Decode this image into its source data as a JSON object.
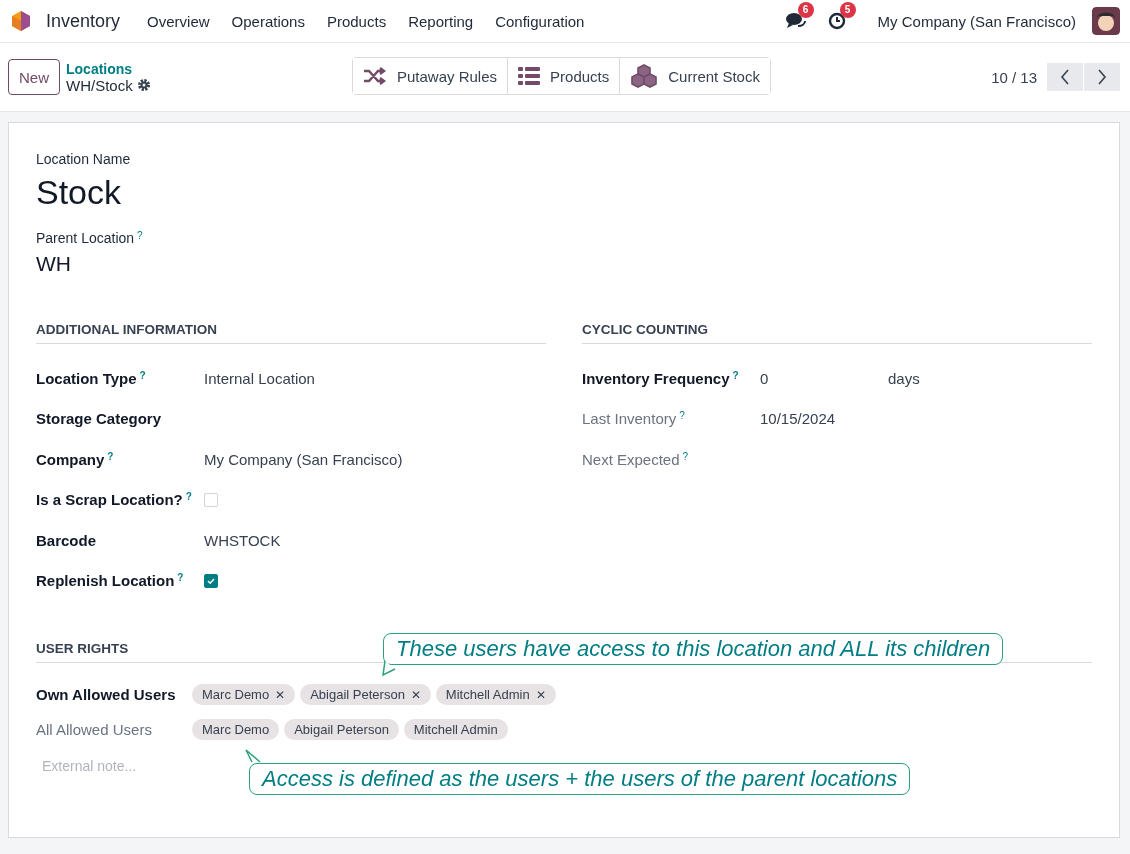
{
  "navbar": {
    "app_name": "Inventory",
    "menu": [
      "Overview",
      "Operations",
      "Products",
      "Reporting",
      "Configuration"
    ],
    "messages_count": "6",
    "activities_count": "5",
    "company": "My Company (San Francisco)"
  },
  "control_panel": {
    "new_button": "New",
    "breadcrumb": "Locations",
    "record_name": "WH/Stock",
    "smart_buttons": [
      {
        "kind": "shuffle",
        "label": "Putaway Rules"
      },
      {
        "kind": "list",
        "label": "Products"
      },
      {
        "kind": "boxes",
        "label": "Current Stock"
      }
    ],
    "pager": "10 / 13"
  },
  "form": {
    "name_label": "Location Name",
    "name": "Stock",
    "parent_label": "Parent Location",
    "parent_help": "?",
    "parent": "WH",
    "left_section": {
      "title": "ADDITIONAL INFORMATION",
      "fields": [
        {
          "kind": "text",
          "label": "Location Type",
          "required": true,
          "help": "?",
          "value": "Internal Location"
        },
        {
          "kind": "empty",
          "label": "Storage Category",
          "required": true
        },
        {
          "kind": "text",
          "label": "Company",
          "required": true,
          "help": "?",
          "value": "My Company (San Francisco)"
        },
        {
          "kind": "checkbox",
          "label": "Is a Scrap Location?",
          "required": true,
          "help": "?",
          "checked": false
        },
        {
          "kind": "text",
          "label": "Barcode",
          "required": true,
          "value": "WHSTOCK"
        },
        {
          "kind": "checkbox",
          "label": "Replenish Location",
          "required": true,
          "help": "?",
          "checked": true
        }
      ]
    },
    "right_section": {
      "title": "CYCLIC COUNTING",
      "fields": [
        {
          "kind": "unit",
          "label": "Inventory Frequency",
          "required": true,
          "help": "?",
          "value": "0",
          "unit": "days"
        },
        {
          "kind": "text",
          "label": "Last Inventory",
          "required": false,
          "help": "?",
          "value": "10/15/2024"
        },
        {
          "kind": "empty",
          "label": "Next Expected",
          "required": false,
          "help": "?"
        }
      ]
    },
    "user_rights": {
      "title": "USER RIGHTS",
      "own_label": "Own Allowed Users",
      "own_users": [
        "Marc Demo",
        "Abigail Peterson",
        "Mitchell Admin"
      ],
      "remove_mark": "✕",
      "all_label": "All Allowed Users",
      "all_users": [
        "Marc Demo",
        "Abigail Peterson",
        "Mitchell Admin"
      ],
      "note_placeholder": "External note..."
    }
  },
  "callouts": [
    {
      "text": "These users have access to this location and ALL its children"
    },
    {
      "text": "Access is defined as the users + the users of the parent locations"
    }
  ]
}
